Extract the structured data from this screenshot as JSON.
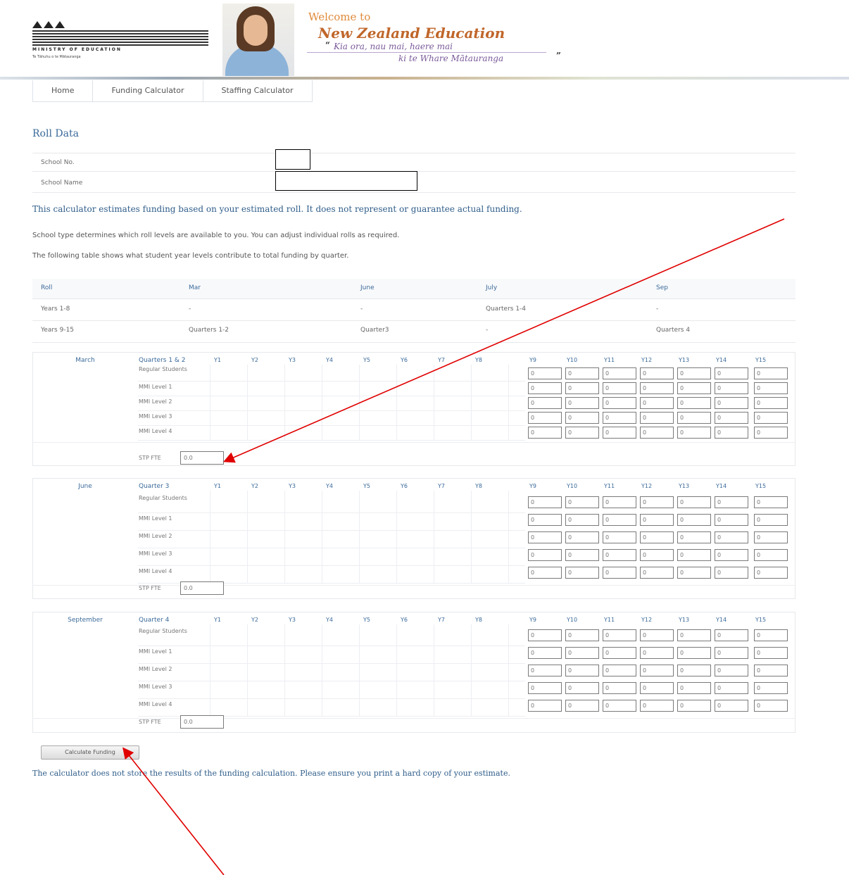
{
  "header": {
    "logo_text": "MINISTRY OF EDUCATION",
    "logo_subtext": "Te Tāhuhu o te Mātauranga",
    "welcome": "Welcome to",
    "site_title": "New Zealand Education",
    "tagline_line1": "Kia ora, nau mai, haere mai",
    "tagline_line2": "ki te Whare Mātauranga"
  },
  "nav": {
    "items": [
      "Home",
      "Funding Calculator",
      "Staffing Calculator"
    ]
  },
  "roll_data": {
    "heading": "Roll Data",
    "school_no_label": "School No.",
    "school_name_label": "School Name"
  },
  "intro": {
    "line1": "This calculator estimates funding based on your estimated roll. It does not represent or guarantee actual funding.",
    "line2": "School type determines which roll levels are available to you. You can adjust individual rolls as required.",
    "line3": "The following table shows what student year levels contribute to total funding by quarter."
  },
  "summary_table": {
    "headers": [
      "Roll",
      "Mar",
      "June",
      "July",
      "Sep"
    ],
    "rows": [
      [
        "Years 1-8",
        "-",
        "-",
        "Quarters 1-4",
        "-"
      ],
      [
        "Years 9-15",
        "Quarters 1-2",
        "Quarter3",
        "-",
        "Quarters 4"
      ]
    ]
  },
  "year_headers": [
    "Y1",
    "Y2",
    "Y3",
    "Y4",
    "Y5",
    "Y6",
    "Y7",
    "Y8",
    "Y9",
    "Y10",
    "Y11",
    "Y12",
    "Y13",
    "Y14",
    "Y15"
  ],
  "row_labels": [
    "Regular Students",
    "MMI Level 1",
    "MMI Level 2",
    "MMI Level 3",
    "MMI Level 4"
  ],
  "stp_label": "STP FTE",
  "quarters": [
    {
      "month": "March",
      "title": "Quarters 1 & 2",
      "stp_value": "0.0",
      "cell_value": "0"
    },
    {
      "month": "June",
      "title": "Quarter 3",
      "stp_value": "0.0",
      "cell_value": "0"
    },
    {
      "month": "September",
      "title": "Quarter 4",
      "stp_value": "0.0",
      "cell_value": "0"
    }
  ],
  "calculate_button": "Calculate Funding",
  "footer_note": "The calculator does not store the results of the funding calculation. Please ensure you print a hard copy of your estimate.",
  "colors": {
    "link_blue": "#2f5d8a",
    "annotation_red": "#e00000",
    "title_orange": "#c0662a"
  }
}
